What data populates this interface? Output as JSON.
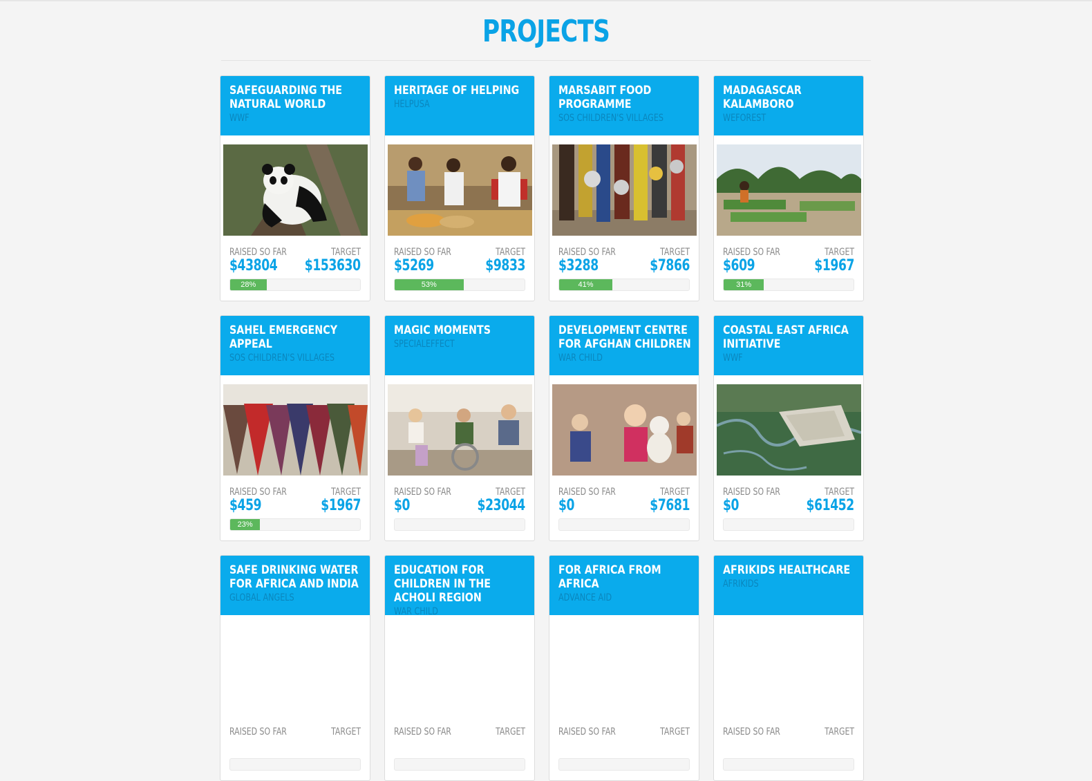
{
  "page": {
    "title": "PROJECTS"
  },
  "labels": {
    "raised": "RAISED SO FAR",
    "target": "TARGET"
  },
  "colors": {
    "accent": "#0aabec",
    "progress": "#5cb85c"
  },
  "projects": [
    {
      "title": "SAFEGUARDING THE NATURAL WORLD",
      "org": "WWF",
      "raised": "$43804",
      "target": "$153630",
      "progress": 0.28,
      "progress_label": "28%",
      "image": "panda-in-tree"
    },
    {
      "title": "HERITAGE OF HELPING",
      "org": "HELPUSA",
      "raised": "$5269",
      "target": "$9833",
      "progress": 0.53,
      "progress_label": "53%",
      "image": "food-service-volunteers"
    },
    {
      "title": "MARSABIT FOOD PROGRAMME",
      "org": "SOS CHILDREN'S VILLAGES",
      "raised": "$3288",
      "target": "$7866",
      "progress": 0.41,
      "progress_label": "41%",
      "image": "children-with-bowls"
    },
    {
      "title": "MADAGASCAR KALAMBORO",
      "org": "WEFOREST",
      "raised": "$609",
      "target": "$1967",
      "progress": 0.31,
      "progress_label": "31%",
      "image": "tree-nursery"
    },
    {
      "title": "SAHEL EMERGENCY APPEAL",
      "org": "SOS CHILDREN'S VILLAGES",
      "raised": "$459",
      "target": "$1967",
      "progress": 0.23,
      "progress_label": "23%",
      "image": "crowd-of-women"
    },
    {
      "title": "MAGIC MOMENTS",
      "org": "SPECIALEFFECT",
      "raised": "$0",
      "target": "$23044",
      "progress": 0,
      "progress_label": "",
      "image": "children-in-classroom"
    },
    {
      "title": "DEVELOPMENT CENTRE FOR AFGHAN CHILDREN",
      "org": "WAR CHILD",
      "raised": "$0",
      "target": "$7681",
      "progress": 0,
      "progress_label": "",
      "image": "girl-with-teddy"
    },
    {
      "title": "COASTAL EAST AFRICA INITIATIVE",
      "org": "WWF",
      "raised": "$0",
      "target": "$61452",
      "progress": 0,
      "progress_label": "",
      "image": "aerial-mangroves"
    },
    {
      "title": "SAFE DRINKING WATER FOR AFRICA AND INDIA",
      "org": "GLOBAL ANGELS",
      "raised": "",
      "target": "",
      "progress": 0,
      "progress_label": "",
      "image": ""
    },
    {
      "title": "EDUCATION FOR CHILDREN IN THE ACHOLI REGION",
      "org": "WAR CHILD",
      "raised": "",
      "target": "",
      "progress": 0,
      "progress_label": "",
      "image": ""
    },
    {
      "title": "FOR AFRICA FROM AFRICA",
      "org": "ADVANCE AID",
      "raised": "",
      "target": "",
      "progress": 0,
      "progress_label": "",
      "image": ""
    },
    {
      "title": "AFRIKIDS HEALTHCARE",
      "org": "AFRIKIDS",
      "raised": "",
      "target": "",
      "progress": 0,
      "progress_label": "",
      "image": ""
    }
  ]
}
